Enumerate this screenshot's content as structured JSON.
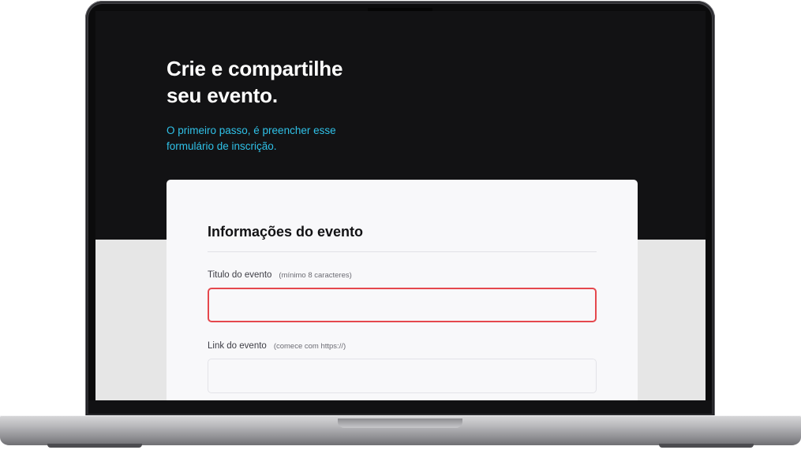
{
  "hero": {
    "title": "Crie e compartilhe\nseu evento.",
    "subtitle": "O primeiro passo, é preencher esse\nformulário de inscrição."
  },
  "form": {
    "section_title": "Informações do evento",
    "fields": [
      {
        "label": "Titulo do evento",
        "hint": "(mínimo 8 caracteres)",
        "value": "",
        "state": "error"
      },
      {
        "label": "Link do evento",
        "hint": "(comece com https://)",
        "value": "",
        "state": "default"
      }
    ]
  },
  "colors": {
    "hero_background": "#121214",
    "accent": "#2fc1e8",
    "error_border": "#e5484d",
    "card_background": "#f8f8fa"
  }
}
